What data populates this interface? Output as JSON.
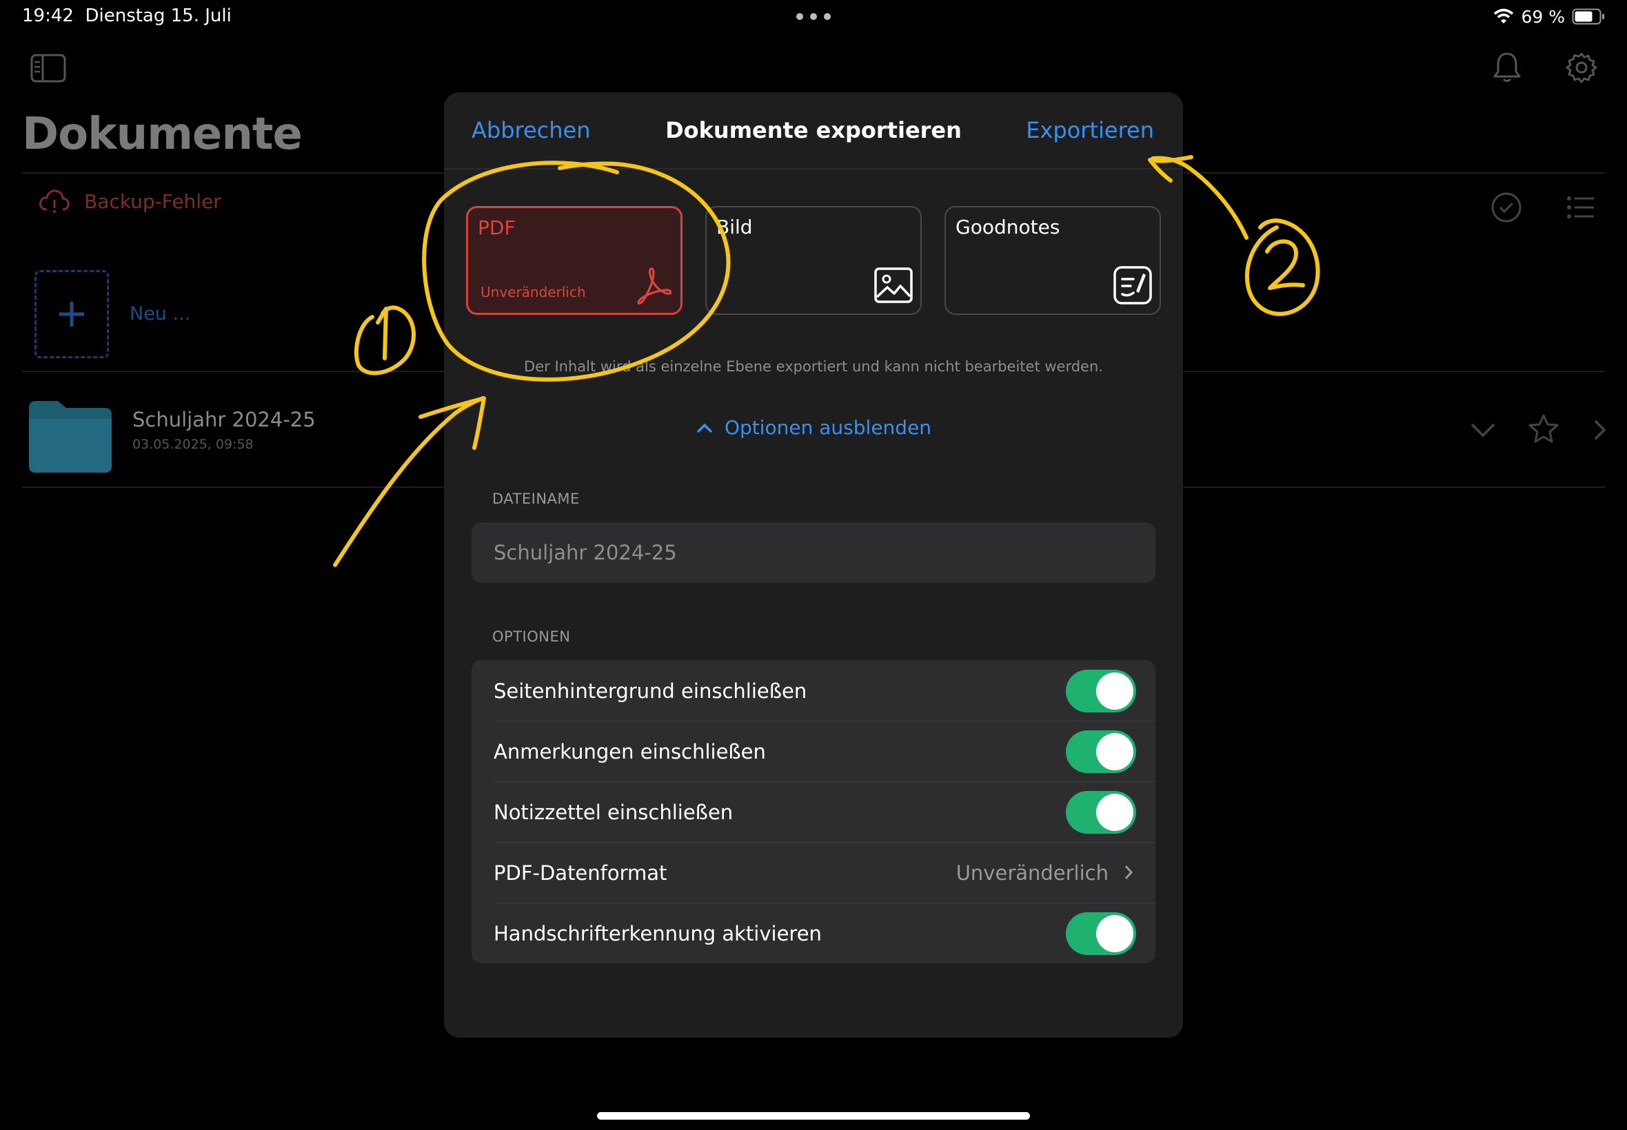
{
  "status_bar": {
    "time": "19:42",
    "date": "Dienstag 15. Juli",
    "battery": "69 %"
  },
  "background": {
    "title": "Dokumente",
    "backup_error": "Backup-Fehler",
    "new_label": "Neu ...",
    "folder": {
      "name": "Schuljahr 2024-25",
      "date": "03.05.2025, 09:58"
    }
  },
  "modal": {
    "cancel_label": "Abbrechen",
    "title": "Dokumente exportieren",
    "export_label": "Exportieren",
    "formats": [
      {
        "label": "PDF",
        "sub": "Unveränderlich",
        "icon": "acrobat-icon",
        "selected": true
      },
      {
        "label": "Bild",
        "sub": "",
        "icon": "image-icon",
        "selected": false
      },
      {
        "label": "Goodnotes",
        "sub": "",
        "icon": "goodnotes-icon",
        "selected": false
      }
    ],
    "format_description": "Der Inhalt wird als einzelne Ebene exportiert und kann nicht bearbeitet werden.",
    "toggle_options_label": "Optionen ausblenden",
    "filename_section": "DATEINAME",
    "filename_placeholder": "Schuljahr 2024-25",
    "options_section": "OPTIONEN",
    "options": [
      {
        "label": "Seitenhintergrund einschließen",
        "type": "switch",
        "on": true
      },
      {
        "label": "Anmerkungen einschließen",
        "type": "switch",
        "on": true
      },
      {
        "label": "Notizzettel einschließen",
        "type": "switch",
        "on": true
      },
      {
        "label": "PDF-Datenformat",
        "type": "value",
        "value": "Unveränderlich"
      },
      {
        "label": "Handschrifterkennung aktivieren",
        "type": "switch",
        "on": true
      }
    ]
  },
  "colors": {
    "accent_blue": "#3a8ff2",
    "pdf_red": "#d9463f",
    "switch_green": "#1fb170",
    "annotation_yellow": "#f5c518"
  }
}
